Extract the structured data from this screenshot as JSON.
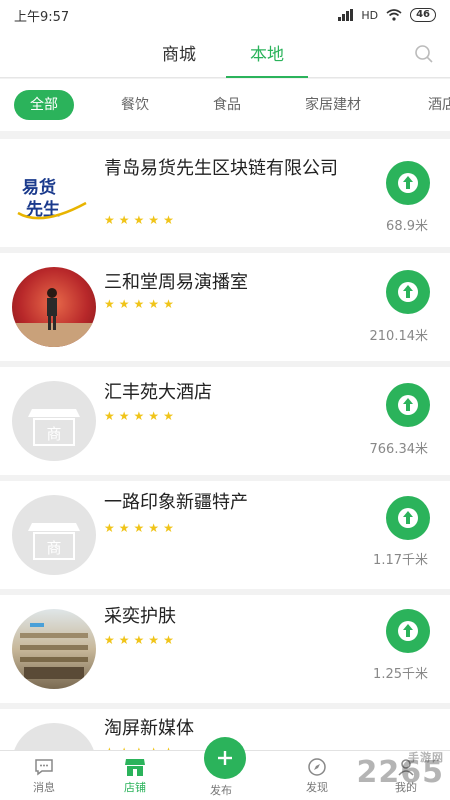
{
  "status_bar": {
    "time": "上午9:57",
    "network": "HD",
    "battery": "46"
  },
  "top_tabs": {
    "mall": "商城",
    "local": "本地"
  },
  "categories": [
    "全部",
    "餐饮",
    "食品",
    "家居建材",
    "酒店"
  ],
  "stores": [
    {
      "name": "青岛易货先生区块链有限公司",
      "distance": "68.9米",
      "rating": 5
    },
    {
      "name": "三和堂周易演播室",
      "distance": "210.14米",
      "rating": 5
    },
    {
      "name": "汇丰苑大酒店",
      "distance": "766.34米",
      "rating": 5
    },
    {
      "name": "一路印象新疆特产",
      "distance": "1.17千米",
      "rating": 5
    },
    {
      "name": "采奕护肤",
      "distance": "1.25千米",
      "rating": 5
    },
    {
      "name": "淘屏新媒体",
      "distance": "",
      "rating": 5
    }
  ],
  "placeholder_text": "商",
  "logo_text": "易货先生",
  "bottom_nav": {
    "messages": "消息",
    "shop": "店铺",
    "publish": "发布",
    "discover": "发现",
    "mine": "我的"
  },
  "watermark": {
    "main": "2265",
    "sub": "手游网"
  },
  "colors": {
    "accent": "#2bb35b",
    "star": "#f0c419"
  }
}
